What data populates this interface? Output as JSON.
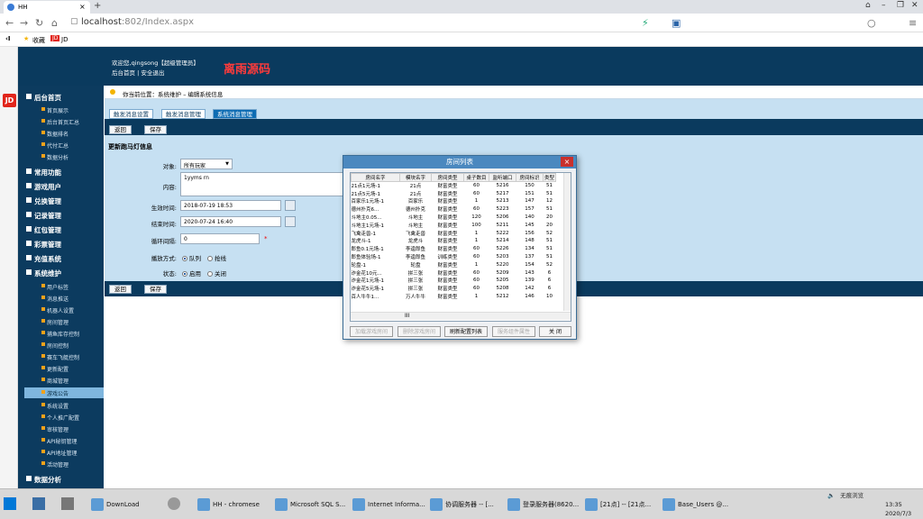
{
  "browser": {
    "tab_title": "HH",
    "url_host": "localhost",
    "url_rest": ":802/Index.aspx",
    "bookmarks": [
      "收藏",
      "JD"
    ]
  },
  "header": {
    "welcome": "欢迎您,qingsong【超级管理员】",
    "links": "后台首页 | 安全退出",
    "brand": "离雨源码"
  },
  "sidebar": {
    "sections_top": [
      "后台首页"
    ],
    "home_items": [
      "首页展示",
      "后台首页汇总",
      "数据排名",
      "代付汇总",
      "数据分析"
    ],
    "sections_mid": [
      "常用功能",
      "游戏用户",
      "兑换管理",
      "记录管理",
      "红包管理",
      "彩票管理",
      "充值系统",
      "系统维护"
    ],
    "sys_items": [
      "用户标签",
      "消息推送",
      "机器人设置",
      "房间管理",
      "捕鱼库存控制",
      "房间控制",
      "赛车飞艇控制",
      "更新配置",
      "商城管理",
      "游戏公告",
      "系统设置",
      "个人推广配置",
      "审核管理",
      "API秘钥管理",
      "API地址管理",
      "活动管理"
    ],
    "sections_bottom": [
      "数据分析"
    ]
  },
  "crumb": "你当前位置：系统维护 – 编辑系统信息",
  "tabs": [
    "触发消息设置",
    "触发消息管理",
    "系统消息管理"
  ],
  "buttons": {
    "back": "返回",
    "save": "保存"
  },
  "form": {
    "title": "更新跑马灯信息",
    "target_label": "对象:",
    "target_value": "所有玩家",
    "content_label": "内容:",
    "content_value": "1yyms rn",
    "start_label": "生效时间:",
    "start_value": "2018-07-19 18:53",
    "end_label": "结束时间:",
    "end_value": "2020-07-24 16:40",
    "interval_label": "循环间隔:",
    "interval_value": "0",
    "required_mark": "*",
    "mode_label": "播放方式:",
    "mode_options": [
      "队列",
      "抢线"
    ],
    "status_label": "状态:",
    "status_options": [
      "启用",
      "关闭"
    ]
  },
  "dialog": {
    "title": "房间列表",
    "close": "×",
    "columns": [
      "房间名字",
      "模块名字",
      "房间类型",
      "桌子数目",
      "监听端口",
      "房间标识",
      "类型"
    ],
    "rows": [
      [
        "21点1元场-1",
        "21点",
        "财富类型",
        "60",
        "5216",
        "150",
        "51"
      ],
      [
        "21点5元场-1",
        "21点",
        "财富类型",
        "60",
        "5217",
        "151",
        "51"
      ],
      [
        "百家乐1元场-1",
        "百家乐",
        "财富类型",
        "1",
        "5213",
        "147",
        "12"
      ],
      [
        "德州扑克6...",
        "德州扑克",
        "财富类型",
        "60",
        "5223",
        "157",
        "51"
      ],
      [
        "斗地主0.05...",
        "斗地主",
        "财富类型",
        "120",
        "5206",
        "140",
        "20"
      ],
      [
        "斗地主1元场-1",
        "斗地主",
        "财富类型",
        "100",
        "5211",
        "145",
        "20"
      ],
      [
        "飞禽走兽-1",
        "飞禽走兽",
        "财富类型",
        "1",
        "5222",
        "156",
        "52"
      ],
      [
        "龙虎斗-1",
        "龙虎斗",
        "财富类型",
        "1",
        "5214",
        "148",
        "51"
      ],
      [
        "郎鱼0.1元场-1",
        "李逵郎鱼",
        "财富类型",
        "60",
        "5226",
        "134",
        "51"
      ],
      [
        "郎鱼体验场-1",
        "李逵郎鱼",
        "训练类型",
        "60",
        "5203",
        "137",
        "51"
      ],
      [
        "轮盘-1",
        "轮盘",
        "财富类型",
        "1",
        "5220",
        "154",
        "52"
      ],
      [
        "诈金花10元...",
        "拼三张",
        "财富类型",
        "60",
        "5209",
        "143",
        "6"
      ],
      [
        "诈金花1元场-1",
        "拼三张",
        "财富类型",
        "60",
        "5205",
        "139",
        "6"
      ],
      [
        "诈金花5元场-1",
        "拼三张",
        "财富类型",
        "60",
        "5208",
        "142",
        "6"
      ],
      [
        "百人牛牛1...",
        "万人牛牛",
        "财富类型",
        "1",
        "5212",
        "146",
        "10"
      ]
    ],
    "scroll_label": "III",
    "buttons": [
      "加载游戏房间",
      "删除游戏房间",
      "刷新配置列表",
      "服务组件属性",
      "关 闭"
    ]
  },
  "taskbar": {
    "items": [
      "DownLoad",
      "HH - chromese",
      "Microsoft SQL S...",
      "Internet Informa...",
      "协调服务器 -- [...",
      "登录服务器(8620...",
      "[21点] -- [21点...",
      "Base_Users @..."
    ],
    "status": "无痕浏览",
    "time": "13:35",
    "date": "2020/7/3"
  }
}
